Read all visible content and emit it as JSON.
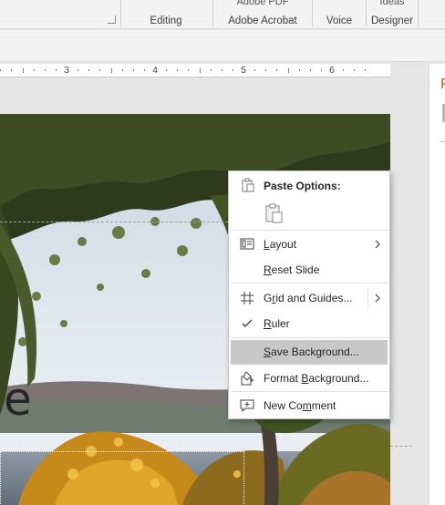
{
  "ribbon": {
    "groups": [
      {
        "top": "",
        "label": "Editing"
      },
      {
        "top": "Adobe PDF",
        "label": "Adobe Acrobat"
      },
      {
        "top": "",
        "label": "Voice"
      },
      {
        "top": "Ideas",
        "label": "Designer"
      }
    ]
  },
  "ruler": {
    "numbers": [
      "3",
      "4",
      "5",
      "6"
    ]
  },
  "slide": {
    "visible_text": "e"
  },
  "right_pane": {
    "title_fragment": "F"
  },
  "context_menu": {
    "paste_options_label": "Paste Options:",
    "items": [
      {
        "label": "Layout",
        "underline": "L",
        "rest": "ayout"
      },
      {
        "label": "Reset Slide",
        "underline": "R",
        "rest": "eset Slide"
      },
      {
        "label": "Grid and Guides...",
        "pre": "G",
        "underline": "r",
        "rest": "id and Guides..."
      },
      {
        "label": "Ruler",
        "underline": "R",
        "rest": "uler"
      },
      {
        "label": "Save Background...",
        "underline": "S",
        "rest": "ave Background..."
      },
      {
        "label": "Format Background...",
        "pre": "Format ",
        "underline": "B",
        "rest": "ackground..."
      },
      {
        "label": "New Comment",
        "pre": "New Co",
        "underline": "m",
        "rest": "ment"
      }
    ],
    "highlighted": "Save Background...",
    "checked": "Ruler"
  },
  "colors": {
    "accent": "#c55a11",
    "highlight": "#c8c8c8"
  }
}
